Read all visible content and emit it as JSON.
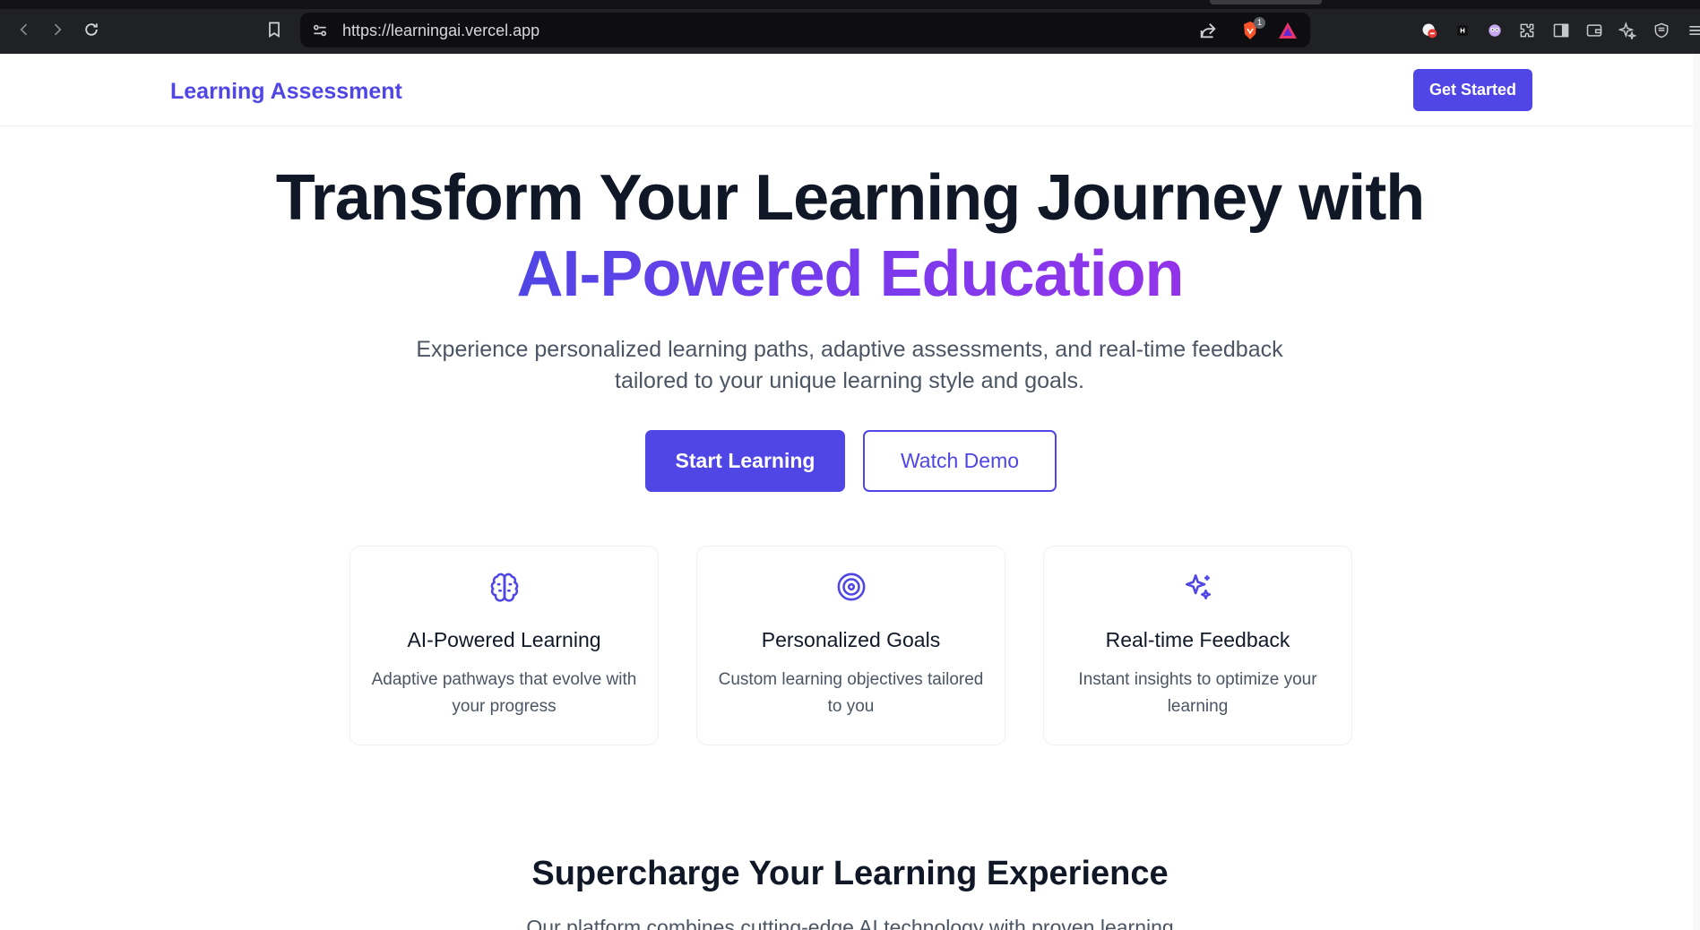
{
  "browser": {
    "url": "https://learningai.vercel.app",
    "brave_shield_count": "1"
  },
  "header": {
    "brand": "Learning Assessment",
    "cta_label": "Get Started"
  },
  "hero": {
    "title_line1": "Transform Your Learning Journey with",
    "title_line2": "AI-Powered Education",
    "subtitle": "Experience personalized learning paths, adaptive assessments, and real-time feedback tailored to your unique learning style and goals.",
    "primary_button": "Start Learning",
    "secondary_button": "Watch Demo"
  },
  "features": [
    {
      "icon": "brain-icon",
      "title": "AI-Powered Learning",
      "description": "Adaptive pathways that evolve with your progress"
    },
    {
      "icon": "target-icon",
      "title": "Personalized Goals",
      "description": "Custom learning objectives tailored to you"
    },
    {
      "icon": "sparkles-icon",
      "title": "Real-time Feedback",
      "description": "Instant insights to optimize your learning"
    }
  ],
  "section": {
    "title": "Supercharge Your Learning Experience",
    "subtitle": "Our platform combines cutting-edge AI technology with proven learning"
  },
  "colors": {
    "accent": "#4f46e5",
    "accent_gradient_end": "#9333ea",
    "heading": "#101828",
    "body_text": "#4b5563"
  }
}
